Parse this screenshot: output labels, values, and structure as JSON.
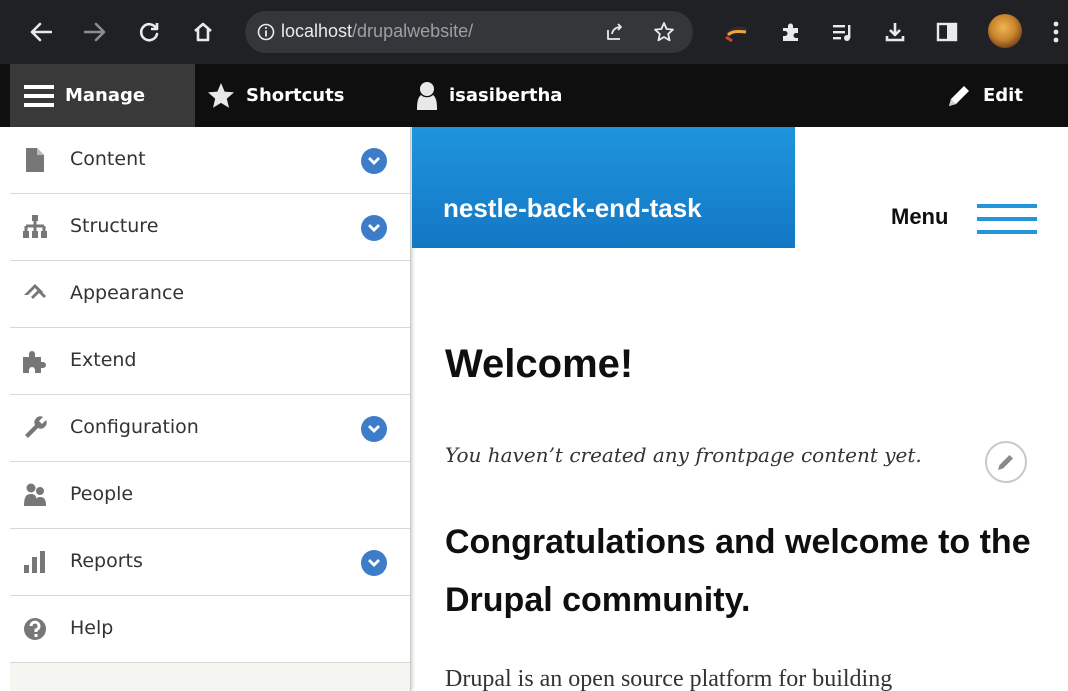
{
  "browser": {
    "url_host": "localhost",
    "url_path": "/drupalwebsite/"
  },
  "toolbar": {
    "manage_label": "Manage",
    "shortcuts_label": "Shortcuts",
    "user_label": "isasibertha",
    "edit_label": "Edit"
  },
  "tray": {
    "items": [
      {
        "label": "Content",
        "icon": "file-icon",
        "has_toggle": true
      },
      {
        "label": "Structure",
        "icon": "sitemap-icon",
        "has_toggle": true
      },
      {
        "label": "Appearance",
        "icon": "paintbrush-icon",
        "has_toggle": false
      },
      {
        "label": "Extend",
        "icon": "puzzle-icon",
        "has_toggle": false
      },
      {
        "label": "Configuration",
        "icon": "wrench-icon",
        "has_toggle": true
      },
      {
        "label": "People",
        "icon": "people-icon",
        "has_toggle": false
      },
      {
        "label": "Reports",
        "icon": "bar-chart-icon",
        "has_toggle": true
      },
      {
        "label": "Help",
        "icon": "help-icon",
        "has_toggle": false
      }
    ]
  },
  "site": {
    "name": "nestle-back-end-task",
    "menu_label": "Menu"
  },
  "main": {
    "welcome": "Welcome!",
    "no_content": "You haven’t created any frontpage content yet.",
    "congrats": "Congratulations and welcome to the Drupal community.",
    "description": "Drupal is an open source platform for building"
  },
  "colors": {
    "brand_blue": "#1e94dc",
    "toggle_blue": "#3d7cc8",
    "toolbar_bg": "#0f0f0f"
  }
}
